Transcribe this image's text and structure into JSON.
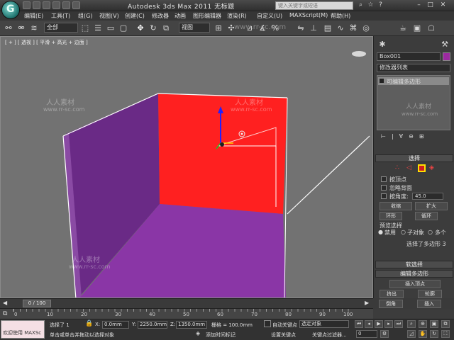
{
  "title_bar": {
    "app_title": "Autodesk 3ds Max  2011         无标题",
    "search_placeholder": "键入关键字或短语",
    "logo_letter": "G",
    "window_buttons": [
      "–",
      "□",
      "✕"
    ]
  },
  "menu": {
    "items": [
      "编辑(E)",
      "工具(T)",
      "组(G)",
      "视图(V)",
      "创建(C)",
      "修改器",
      "动画",
      "图形编辑器",
      "渲染(R)",
      "自定义(U)",
      "MAXScript(M)",
      "帮助(H)"
    ]
  },
  "toolbar": {
    "selection_filter": "全部",
    "view_dropdown": "视图",
    "watermark": "www.rr-sc.com"
  },
  "viewport": {
    "label": "[ + ] [ 透视 ] [ 平滑 + 高光 + 边面 ]",
    "watermarks": [
      "人人素材",
      "www.rr-sc.com"
    ],
    "colors": {
      "background": "#727272",
      "red_wall": "#ff2020",
      "purple": "#6a2a86",
      "floor": "#8a36a6"
    }
  },
  "command_panel": {
    "object_name": "Box001",
    "object_color": "#9c2aa0",
    "modifier_list": "修改器列表",
    "stack_item": "可编辑多边形",
    "selection_title": "选择",
    "by_vertex": "按顶点",
    "ignore_backfacing": "忽略背面",
    "by_angle": "按角度:",
    "angle_value": "45.0",
    "shrink": "收缩",
    "grow": "扩大",
    "ring": "环形",
    "loop": "循环",
    "preview_selection": "预览选择",
    "disabled": "禁用",
    "subobject": "子对象",
    "multi": "多个",
    "selected_info": "选择了多边形 3",
    "soft_selection": "软选择",
    "edit_polygons": "编辑多边形",
    "insert_vertex": "插入顶点",
    "extrude": "挤出",
    "outline": "轮廓",
    "bevel": "倒角",
    "inset": "插入"
  },
  "timeline": {
    "slider": "0 / 100",
    "ticks": [
      "0",
      "10",
      "20",
      "30",
      "40",
      "50",
      "60",
      "70",
      "80",
      "90",
      "100"
    ]
  },
  "statusbar": {
    "maxscript_label": "欢迎使用 MAXSc",
    "selected": "选择了 1",
    "prompt": "单击或单击并拖动以选择对象",
    "x_label": "X:",
    "x_value": "0.0mm",
    "y_label": "Y:",
    "y_value": "2250.0mm",
    "z_label": "Z:",
    "z_value": "1350.0mm",
    "grid": "栅格 = 100.0mm",
    "add_time_tag": "添加时间标记",
    "auto_key": "自动关键点",
    "selected_obj": "选定对象",
    "set_key": "设置关键点",
    "key_filters": "关键点过滤器...",
    "frame": "0"
  }
}
